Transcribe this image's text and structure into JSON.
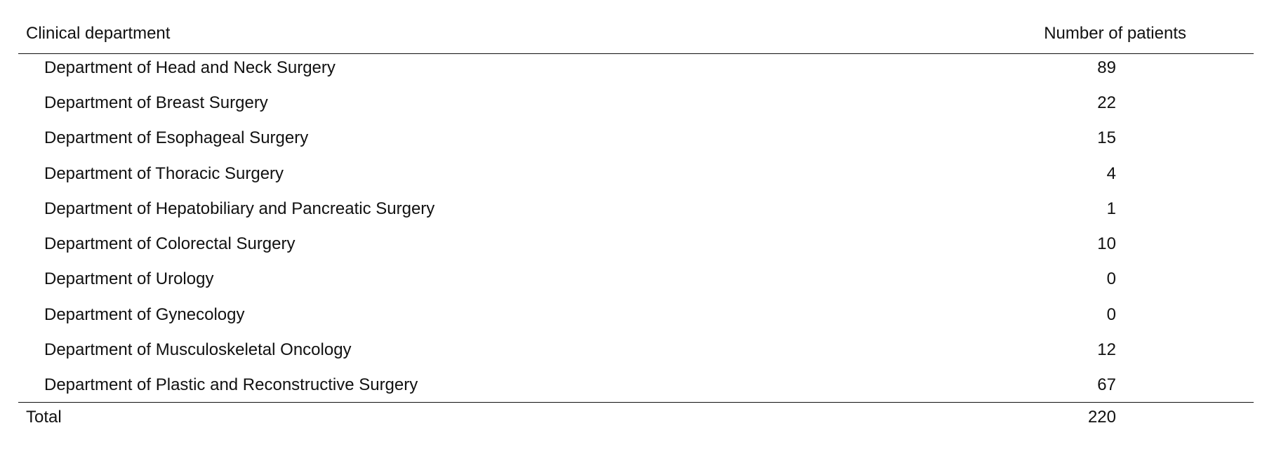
{
  "table": {
    "columns": [
      "Clinical department",
      "Number of patients"
    ],
    "rows": [
      {
        "department": "Department of Head and Neck Surgery",
        "patients": "89"
      },
      {
        "department": "Department of Breast Surgery",
        "patients": "22"
      },
      {
        "department": "Department of Esophageal Surgery",
        "patients": "15"
      },
      {
        "department": "Department of Thoracic Surgery",
        "patients": "4"
      },
      {
        "department": "Department of Hepatobiliary and Pancreatic Surgery",
        "patients": "1"
      },
      {
        "department": "Department of Colorectal Surgery",
        "patients": "10"
      },
      {
        "department": "Department of Urology",
        "patients": "0"
      },
      {
        "department": "Department of Gynecology",
        "patients": "0"
      },
      {
        "department": "Department of Musculoskeletal Oncology",
        "patients": "12"
      },
      {
        "department": "Department of Plastic and Reconstructive Surgery",
        "patients": "67"
      }
    ],
    "total": {
      "label": "Total",
      "patients": "220"
    }
  }
}
